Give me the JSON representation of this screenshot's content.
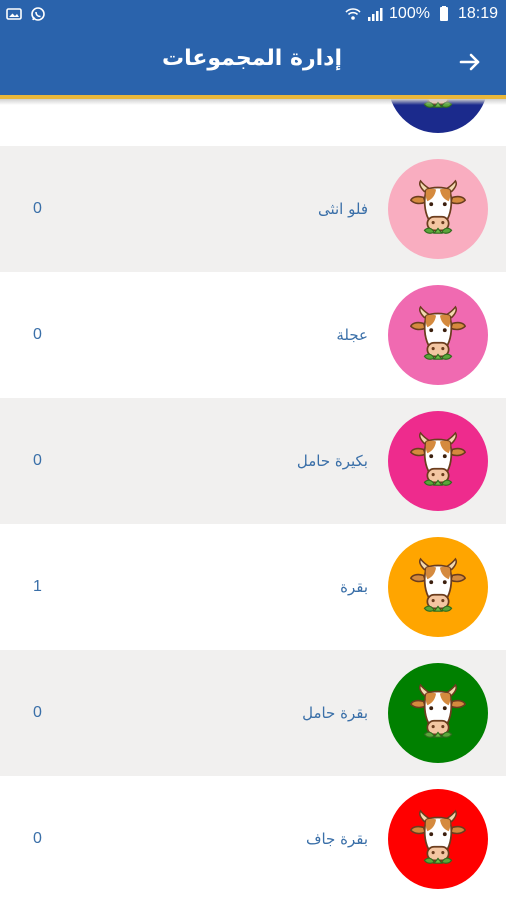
{
  "status_bar": {
    "battery_percent": "100%",
    "time": "18:19"
  },
  "header": {
    "title": "إدارة المجموعات"
  },
  "colors": {
    "primary": "#2a63ac",
    "accent": "#e9b73a",
    "text": "#3a6fa8"
  },
  "groups": [
    {
      "label": "",
      "count": "",
      "color": "#1b2a8c",
      "icon": "cow-icon"
    },
    {
      "label": "فلو انثى",
      "count": "0",
      "color": "#f9adc0",
      "icon": "cow-icon"
    },
    {
      "label": "عجلة",
      "count": "0",
      "color": "#f06ab1",
      "icon": "cow-icon"
    },
    {
      "label": "بكيرة حامل",
      "count": "0",
      "color": "#ee2b8d",
      "icon": "cow-icon"
    },
    {
      "label": "بقرة",
      "count": "1",
      "color": "#ffa500",
      "icon": "cow-icon"
    },
    {
      "label": "بقرة حامل",
      "count": "0",
      "color": "#008000",
      "icon": "cow-icon"
    },
    {
      "label": "بقرة جاف",
      "count": "0",
      "color": "#ff0000",
      "icon": "cow-icon"
    }
  ]
}
